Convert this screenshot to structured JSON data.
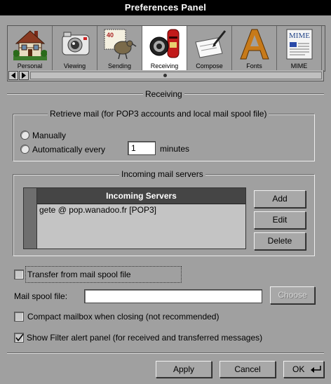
{
  "window": {
    "title": "Preferences Panel"
  },
  "tabs": [
    {
      "label": "Personal",
      "icon": "house-icon"
    },
    {
      "label": "Viewing",
      "icon": "camera-icon"
    },
    {
      "label": "Sending",
      "icon": "stamp-bird-icon"
    },
    {
      "label": "Receiving",
      "icon": "mailbox-icon",
      "active": true
    },
    {
      "label": "Compose",
      "icon": "pen-letter-icon"
    },
    {
      "label": "Fonts",
      "icon": "letter-a-icon"
    },
    {
      "label": "MIME",
      "icon": "mime-document-icon"
    }
  ],
  "section": {
    "title": "Receiving"
  },
  "retrieve": {
    "title": "Retrieve mail (for POP3 accounts and local mail spool file)",
    "manually_label": "Manually",
    "auto_label": "Automatically every",
    "interval_value": "1",
    "minutes_label": "minutes",
    "selected": "none"
  },
  "servers": {
    "group_title": "Incoming mail servers",
    "column_header": "Incoming Servers",
    "rows": [
      "gete @ pop.wanadoo.fr [POP3]"
    ],
    "add_label": "Add",
    "edit_label": "Edit",
    "delete_label": "Delete"
  },
  "options": {
    "transfer_label": "Transfer from mail spool file",
    "transfer_checked": false,
    "spool_label": "Mail spool file:",
    "spool_value": "",
    "choose_label": "Choose",
    "compact_label": "Compact mailbox when closing (not recommended)",
    "compact_checked": false,
    "filter_label": "Show Filter alert panel (for received and transferred messages)",
    "filter_checked": true
  },
  "footer": {
    "apply_label": "Apply",
    "cancel_label": "Cancel",
    "ok_label": "OK"
  }
}
